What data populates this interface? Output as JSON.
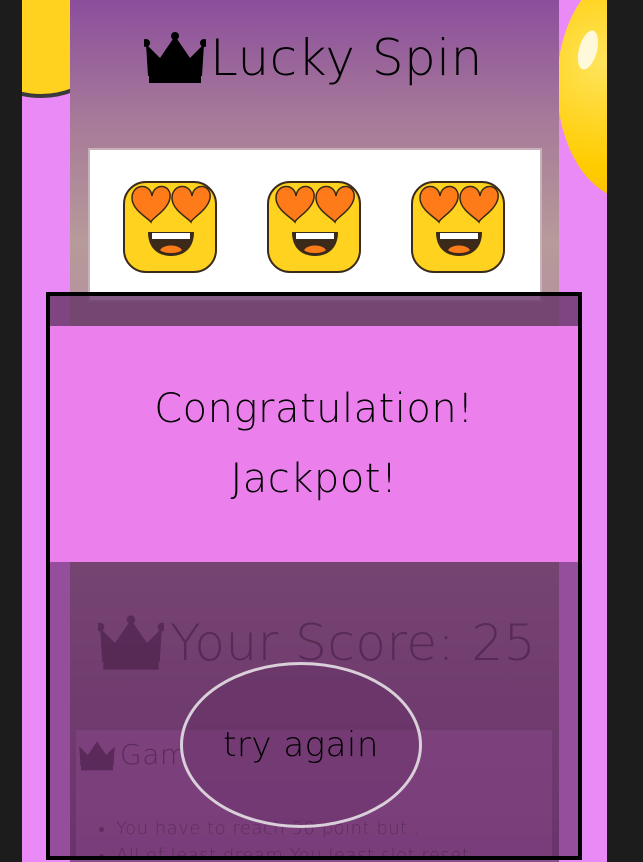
{
  "app": {
    "title": "Lucky Spin",
    "crown_icon": "crown-icon"
  },
  "reels": [
    {
      "symbol": "heart-eyes-emoji-icon"
    },
    {
      "symbol": "heart-eyes-emoji-icon"
    },
    {
      "symbol": "heart-eyes-emoji-icon"
    }
  ],
  "result_modal": {
    "line1": "Congratulation!",
    "line2": "Jackpot!",
    "button_label": "try again"
  },
  "score": {
    "label": "Your Score: 25"
  },
  "rules": {
    "title": "Gam",
    "items": [
      "You have to reach 50 point but..",
      "All of least dream You least slot reset"
    ]
  },
  "colors": {
    "background": "#e98af6",
    "modal_message": "#eb80ed",
    "emoji_face": "#ffd21f",
    "emoji_heart": "#ff7a18"
  }
}
